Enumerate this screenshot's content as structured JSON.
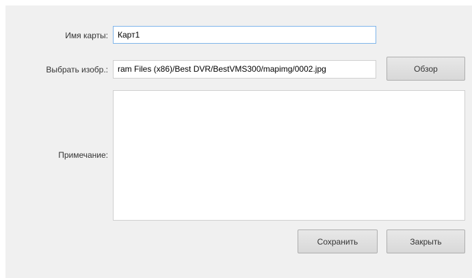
{
  "form": {
    "map_name_label": "Имя карты:",
    "map_name_value": "Карт1",
    "image_label": "Выбрать изобр.:",
    "image_path_value": "ram Files (x86)/Best DVR/BestVMS300/mapimg/0002.jpg",
    "note_label": "Примечание:",
    "note_value": ""
  },
  "buttons": {
    "browse": "Обзор",
    "save": "Сохранить",
    "close": "Закрыть"
  },
  "colors": {
    "dialog_background": "#f0f0f0",
    "focus_border": "#7eb4ea",
    "button_border": "#adadad"
  }
}
